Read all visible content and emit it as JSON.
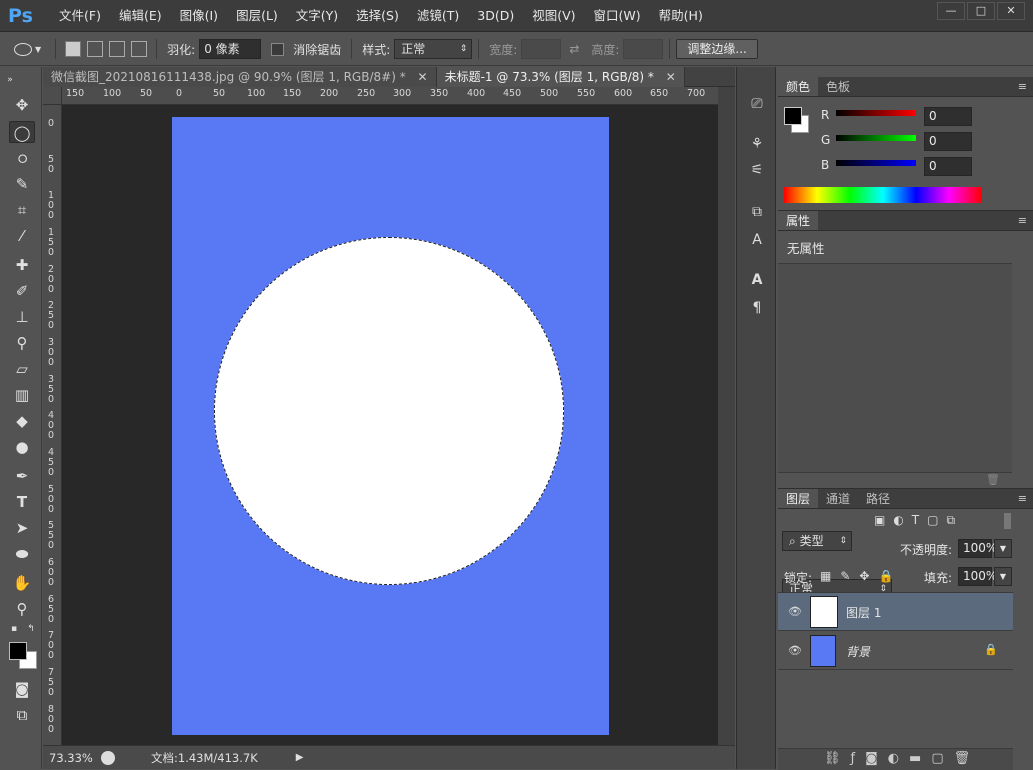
{
  "app": {
    "logo": "Ps"
  },
  "menu": [
    "文件(F)",
    "编辑(E)",
    "图像(I)",
    "图层(L)",
    "文字(Y)",
    "选择(S)",
    "滤镜(T)",
    "3D(D)",
    "视图(V)",
    "窗口(W)",
    "帮助(H)"
  ],
  "window_buttons": {
    "minimize": "—",
    "restore": "□",
    "close": "✕"
  },
  "options": {
    "feather_label": "羽化:",
    "feather_value": "0 像素",
    "antialias_label": "消除锯齿",
    "style_label": "样式:",
    "style_value": "正常",
    "width_label": "宽度:",
    "height_label": "高度:",
    "refine_button": "调整边缘..."
  },
  "tabs": [
    {
      "label": "微信截图_20210816111438.jpg @ 90.9% (图层 1, RGB/8#) *",
      "close": "✕"
    },
    {
      "label": "未标题-1 @ 73.3% (图层 1, RGB/8) *",
      "close": "✕"
    }
  ],
  "ruler": {
    "h_ticks": [
      "150",
      "100",
      "50",
      "0",
      "50",
      "100",
      "150",
      "200",
      "250",
      "300",
      "350",
      "400",
      "450",
      "500",
      "550",
      "600",
      "650",
      "700"
    ],
    "v_ticks": [
      "0",
      "5 0",
      "1 0 0",
      "1 5 0",
      "2 0 0",
      "2 5 0",
      "3 0 0",
      "3 5 0",
      "4 0 0",
      "4 5 0",
      "5 0 0",
      "5 5 0",
      "6 0 0",
      "6 5 0",
      "7 0 0",
      "7 5 0",
      "8 0 0"
    ]
  },
  "status": {
    "zoom": "73.33%",
    "doc_info": "文档:1.43M/413.7K"
  },
  "colors": {
    "document_bg": "#5878f4",
    "circle": "#ffffff",
    "accent": "#4ea6f5"
  },
  "color_panel": {
    "tabs": [
      "颜色",
      "色板"
    ],
    "r_label": "R",
    "g_label": "G",
    "b_label": "B",
    "r_value": "0",
    "g_value": "0",
    "b_value": "0"
  },
  "properties_panel": {
    "tab": "属性",
    "content": "无属性"
  },
  "layers_panel": {
    "tabs": [
      "图层",
      "通道",
      "路径"
    ],
    "filter_label": "类型",
    "blend_mode": "正常",
    "opacity_label": "不透明度:",
    "opacity_value": "100%",
    "lock_label": "锁定:",
    "fill_label": "填充:",
    "fill_value": "100%",
    "layers": [
      {
        "name": "图层 1"
      },
      {
        "name": "背景"
      }
    ]
  }
}
